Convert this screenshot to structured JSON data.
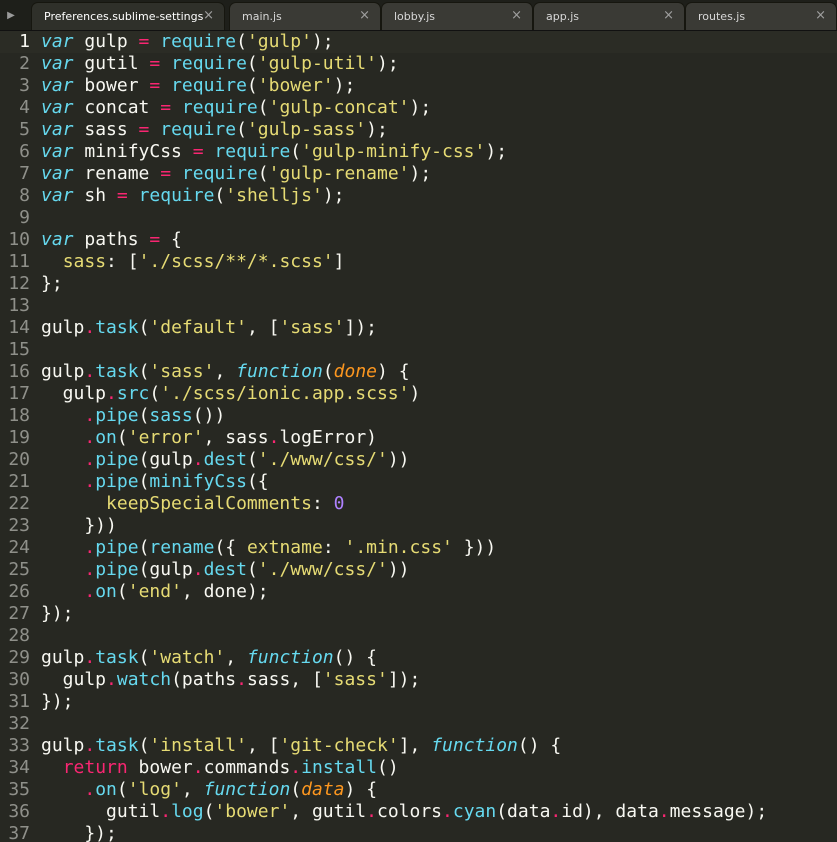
{
  "tabs": [
    {
      "label": "Preferences.sublime-settings",
      "active": true
    },
    {
      "label": "main.js",
      "active": false
    },
    {
      "label": "lobby.js",
      "active": false
    },
    {
      "label": "app.js",
      "active": false
    },
    {
      "label": "routes.js",
      "active": false
    }
  ],
  "close_glyph": "×",
  "side_toggle_glyph": "▶",
  "current_line": 1,
  "colors": {
    "background": "#272822",
    "keyword": "#66d9ef",
    "string": "#e6db74",
    "operator": "#f92672",
    "number": "#ae81ff",
    "parameter": "#fd971f",
    "text": "#f8f8f2",
    "gutter": "#8f908a"
  },
  "lines": [
    [
      [
        "kw",
        "var"
      ],
      [
        "txt",
        " gulp "
      ],
      [
        "op",
        "="
      ],
      [
        "txt",
        " "
      ],
      [
        "fn",
        "require"
      ],
      [
        "txt",
        "("
      ],
      [
        "str",
        "'gulp'"
      ],
      [
        "txt",
        ");"
      ]
    ],
    [
      [
        "kw",
        "var"
      ],
      [
        "txt",
        " gutil "
      ],
      [
        "op",
        "="
      ],
      [
        "txt",
        " "
      ],
      [
        "fn",
        "require"
      ],
      [
        "txt",
        "("
      ],
      [
        "str",
        "'gulp-util'"
      ],
      [
        "txt",
        ");"
      ]
    ],
    [
      [
        "kw",
        "var"
      ],
      [
        "txt",
        " bower "
      ],
      [
        "op",
        "="
      ],
      [
        "txt",
        " "
      ],
      [
        "fn",
        "require"
      ],
      [
        "txt",
        "("
      ],
      [
        "str",
        "'bower'"
      ],
      [
        "txt",
        ");"
      ]
    ],
    [
      [
        "kw",
        "var"
      ],
      [
        "txt",
        " concat "
      ],
      [
        "op",
        "="
      ],
      [
        "txt",
        " "
      ],
      [
        "fn",
        "require"
      ],
      [
        "txt",
        "("
      ],
      [
        "str",
        "'gulp-concat'"
      ],
      [
        "txt",
        ");"
      ]
    ],
    [
      [
        "kw",
        "var"
      ],
      [
        "txt",
        " sass "
      ],
      [
        "op",
        "="
      ],
      [
        "txt",
        " "
      ],
      [
        "fn",
        "require"
      ],
      [
        "txt",
        "("
      ],
      [
        "str",
        "'gulp-sass'"
      ],
      [
        "txt",
        ");"
      ]
    ],
    [
      [
        "kw",
        "var"
      ],
      [
        "txt",
        " minifyCss "
      ],
      [
        "op",
        "="
      ],
      [
        "txt",
        " "
      ],
      [
        "fn",
        "require"
      ],
      [
        "txt",
        "("
      ],
      [
        "str",
        "'gulp-minify-css'"
      ],
      [
        "txt",
        ");"
      ]
    ],
    [
      [
        "kw",
        "var"
      ],
      [
        "txt",
        " rename "
      ],
      [
        "op",
        "="
      ],
      [
        "txt",
        " "
      ],
      [
        "fn",
        "require"
      ],
      [
        "txt",
        "("
      ],
      [
        "str",
        "'gulp-rename'"
      ],
      [
        "txt",
        ");"
      ]
    ],
    [
      [
        "kw",
        "var"
      ],
      [
        "txt",
        " sh "
      ],
      [
        "op",
        "="
      ],
      [
        "txt",
        " "
      ],
      [
        "fn",
        "require"
      ],
      [
        "txt",
        "("
      ],
      [
        "str",
        "'shelljs'"
      ],
      [
        "txt",
        ");"
      ]
    ],
    [],
    [
      [
        "kw",
        "var"
      ],
      [
        "txt",
        " paths "
      ],
      [
        "op",
        "="
      ],
      [
        "txt",
        " {"
      ]
    ],
    [
      [
        "txt",
        "  "
      ],
      [
        "str",
        "sass"
      ],
      [
        "txt",
        ": ["
      ],
      [
        "str",
        "'./scss/**/*.scss'"
      ],
      [
        "txt",
        "]"
      ]
    ],
    [
      [
        "txt",
        "};"
      ]
    ],
    [],
    [
      [
        "txt",
        "gulp"
      ],
      [
        "op",
        "."
      ],
      [
        "fn",
        "task"
      ],
      [
        "txt",
        "("
      ],
      [
        "str",
        "'default'"
      ],
      [
        "txt",
        ", ["
      ],
      [
        "str",
        "'sass'"
      ],
      [
        "txt",
        "]);"
      ]
    ],
    [],
    [
      [
        "txt",
        "gulp"
      ],
      [
        "op",
        "."
      ],
      [
        "fn",
        "task"
      ],
      [
        "txt",
        "("
      ],
      [
        "str",
        "'sass'"
      ],
      [
        "txt",
        ", "
      ],
      [
        "kw",
        "function"
      ],
      [
        "txt",
        "("
      ],
      [
        "par",
        "done"
      ],
      [
        "txt",
        ") {"
      ]
    ],
    [
      [
        "txt",
        "  gulp"
      ],
      [
        "op",
        "."
      ],
      [
        "fn",
        "src"
      ],
      [
        "txt",
        "("
      ],
      [
        "str",
        "'./scss/ionic.app.scss'"
      ],
      [
        "txt",
        ")"
      ]
    ],
    [
      [
        "txt",
        "    "
      ],
      [
        "op",
        "."
      ],
      [
        "fn",
        "pipe"
      ],
      [
        "txt",
        "("
      ],
      [
        "fn",
        "sass"
      ],
      [
        "txt",
        "())"
      ]
    ],
    [
      [
        "txt",
        "    "
      ],
      [
        "op",
        "."
      ],
      [
        "fn",
        "on"
      ],
      [
        "txt",
        "("
      ],
      [
        "str",
        "'error'"
      ],
      [
        "txt",
        ", sass"
      ],
      [
        "op",
        "."
      ],
      [
        "txt",
        "logError)"
      ]
    ],
    [
      [
        "txt",
        "    "
      ],
      [
        "op",
        "."
      ],
      [
        "fn",
        "pipe"
      ],
      [
        "txt",
        "(gulp"
      ],
      [
        "op",
        "."
      ],
      [
        "fn",
        "dest"
      ],
      [
        "txt",
        "("
      ],
      [
        "str",
        "'./www/css/'"
      ],
      [
        "txt",
        "))"
      ]
    ],
    [
      [
        "txt",
        "    "
      ],
      [
        "op",
        "."
      ],
      [
        "fn",
        "pipe"
      ],
      [
        "txt",
        "("
      ],
      [
        "fn",
        "minifyCss"
      ],
      [
        "txt",
        "({"
      ]
    ],
    [
      [
        "txt",
        "      "
      ],
      [
        "str",
        "keepSpecialComments"
      ],
      [
        "txt",
        ": "
      ],
      [
        "num",
        "0"
      ]
    ],
    [
      [
        "txt",
        "    }))"
      ]
    ],
    [
      [
        "txt",
        "    "
      ],
      [
        "op",
        "."
      ],
      [
        "fn",
        "pipe"
      ],
      [
        "txt",
        "("
      ],
      [
        "fn",
        "rename"
      ],
      [
        "txt",
        "({ "
      ],
      [
        "str",
        "extname"
      ],
      [
        "txt",
        ": "
      ],
      [
        "str",
        "'.min.css'"
      ],
      [
        "txt",
        " }))"
      ]
    ],
    [
      [
        "txt",
        "    "
      ],
      [
        "op",
        "."
      ],
      [
        "fn",
        "pipe"
      ],
      [
        "txt",
        "(gulp"
      ],
      [
        "op",
        "."
      ],
      [
        "fn",
        "dest"
      ],
      [
        "txt",
        "("
      ],
      [
        "str",
        "'./www/css/'"
      ],
      [
        "txt",
        "))"
      ]
    ],
    [
      [
        "txt",
        "    "
      ],
      [
        "op",
        "."
      ],
      [
        "fn",
        "on"
      ],
      [
        "txt",
        "("
      ],
      [
        "str",
        "'end'"
      ],
      [
        "txt",
        ", done);"
      ]
    ],
    [
      [
        "txt",
        "});"
      ]
    ],
    [],
    [
      [
        "txt",
        "gulp"
      ],
      [
        "op",
        "."
      ],
      [
        "fn",
        "task"
      ],
      [
        "txt",
        "("
      ],
      [
        "str",
        "'watch'"
      ],
      [
        "txt",
        ", "
      ],
      [
        "kw",
        "function"
      ],
      [
        "txt",
        "() {"
      ]
    ],
    [
      [
        "txt",
        "  gulp"
      ],
      [
        "op",
        "."
      ],
      [
        "fn",
        "watch"
      ],
      [
        "txt",
        "(paths"
      ],
      [
        "op",
        "."
      ],
      [
        "txt",
        "sass, ["
      ],
      [
        "str",
        "'sass'"
      ],
      [
        "txt",
        "]);"
      ]
    ],
    [
      [
        "txt",
        "});"
      ]
    ],
    [],
    [
      [
        "txt",
        "gulp"
      ],
      [
        "op",
        "."
      ],
      [
        "fn",
        "task"
      ],
      [
        "txt",
        "("
      ],
      [
        "str",
        "'install'"
      ],
      [
        "txt",
        ", ["
      ],
      [
        "str",
        "'git-check'"
      ],
      [
        "txt",
        "], "
      ],
      [
        "kw",
        "function"
      ],
      [
        "txt",
        "() {"
      ]
    ],
    [
      [
        "txt",
        "  "
      ],
      [
        "ret",
        "return"
      ],
      [
        "txt",
        " bower"
      ],
      [
        "op",
        "."
      ],
      [
        "txt",
        "commands"
      ],
      [
        "op",
        "."
      ],
      [
        "fn",
        "install"
      ],
      [
        "txt",
        "()"
      ]
    ],
    [
      [
        "txt",
        "    "
      ],
      [
        "op",
        "."
      ],
      [
        "fn",
        "on"
      ],
      [
        "txt",
        "("
      ],
      [
        "str",
        "'log'"
      ],
      [
        "txt",
        ", "
      ],
      [
        "kw",
        "function"
      ],
      [
        "txt",
        "("
      ],
      [
        "par",
        "data"
      ],
      [
        "txt",
        ") {"
      ]
    ],
    [
      [
        "txt",
        "      gutil"
      ],
      [
        "op",
        "."
      ],
      [
        "fn",
        "log"
      ],
      [
        "txt",
        "("
      ],
      [
        "str",
        "'bower'"
      ],
      [
        "txt",
        ", gutil"
      ],
      [
        "op",
        "."
      ],
      [
        "txt",
        "colors"
      ],
      [
        "op",
        "."
      ],
      [
        "fn",
        "cyan"
      ],
      [
        "txt",
        "(data"
      ],
      [
        "op",
        "."
      ],
      [
        "txt",
        "id), data"
      ],
      [
        "op",
        "."
      ],
      [
        "txt",
        "message);"
      ]
    ],
    [
      [
        "txt",
        "    });"
      ]
    ]
  ]
}
